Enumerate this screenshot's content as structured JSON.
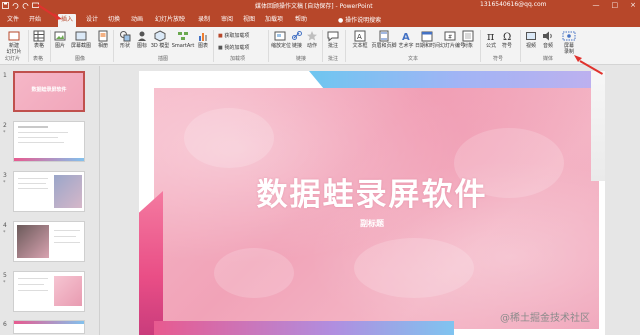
{
  "titlebar": {
    "title": "媒体回顾操作文稿 [自动保存] - PowerPoint",
    "account": "1316540616@qq.com",
    "controls": [
      "—",
      "□",
      "×"
    ]
  },
  "tabs": {
    "items": [
      "文件",
      "开始",
      "插入",
      "设计",
      "切换",
      "动画",
      "幻灯片放映",
      "录制",
      "审阅",
      "视图",
      "加载项",
      "帮助"
    ],
    "active": "插入",
    "search": "操作说明搜索"
  },
  "ribbon": {
    "new_slide": "新建\n幻灯片",
    "table": "表格",
    "image": "图片",
    "screenshot": "屏幕截图",
    "album": "相册",
    "shapes": "形状",
    "icons": "图标",
    "models3d": "3D 模型",
    "smartart": "SmartArt",
    "chart": "图表",
    "get_addins": "获取加载项",
    "my_addins": "我的加载项",
    "zoom": "缩放定位",
    "link": "链接",
    "action": "动作",
    "comment": "批注",
    "textbox": "文本框",
    "header_footer": "页眉和页脚",
    "wordart": "艺术字",
    "datetime": "日期和时间",
    "slide_number": "幻灯片编号",
    "object": "对象",
    "equation": "公式",
    "symbol": "符号",
    "video": "视频",
    "audio": "音频",
    "screen_record": "屏幕\n录制",
    "groups": {
      "slides": "幻灯片",
      "tables": "表格",
      "images": "图像",
      "illustrations": "插图",
      "addins": "加载项",
      "links": "链接",
      "comments": "批注",
      "text": "文本",
      "symbols": "符号",
      "media": "媒体"
    }
  },
  "thumbnails": {
    "numbers": [
      "1",
      "2",
      "3",
      "4",
      "5",
      "6"
    ],
    "star": "*",
    "first_title": "数据蛙录屏软件"
  },
  "slide": {
    "title": "数据蛙录屏软件",
    "subtitle": "副标题"
  },
  "watermark": "@稀土掘金技术社区",
  "colors": {
    "accent": "#b7472a",
    "annotation": "#e0322d"
  }
}
